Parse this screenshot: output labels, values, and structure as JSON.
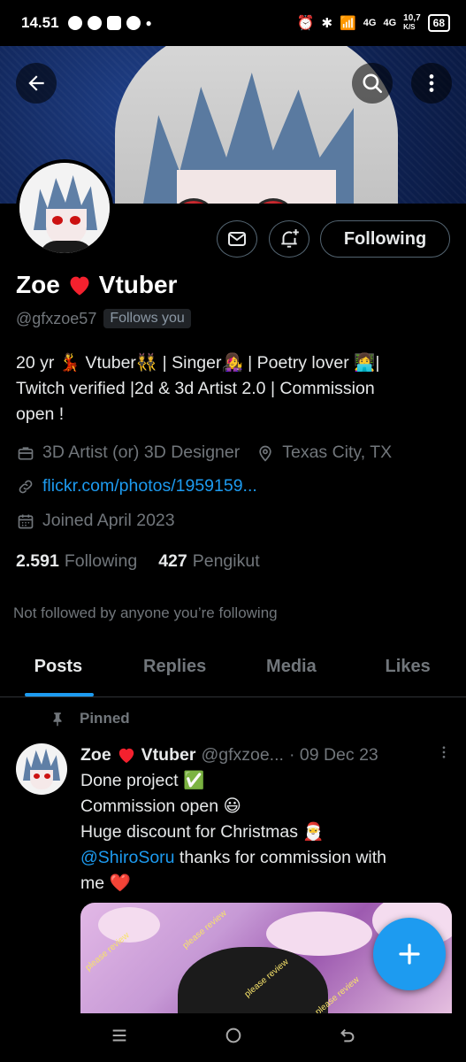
{
  "status_bar": {
    "time": "14.51",
    "network_1": "4G",
    "network_2": "4G",
    "speed": "10,7",
    "speed_unit": "K/S",
    "battery": "68"
  },
  "profile": {
    "name": "Zoe",
    "name_suffix": "Vtuber",
    "handle": "@gfxzoe57",
    "follows_you": "Follows you",
    "bio_line1": "20 yr 💃 Vtuber👯 | Singer👩‍🎤 | Poetry lover 👩‍💻|",
    "bio_line2": "Twitch verified |2d & 3d Artist 2.0 | Commission",
    "bio_line3": "open !",
    "profession": "3D Artist (or) 3D Designer",
    "location": "Texas City, TX",
    "website": "flickr.com/photos/1959159...",
    "joined": "Joined April 2023",
    "following_count": "2.591",
    "following_label": "Following",
    "followers_count": "427",
    "followers_label": "Pengikut",
    "not_followed": "Not followed by anyone you’re following"
  },
  "actions": {
    "following_button": "Following"
  },
  "tabs": [
    {
      "label": "Posts"
    },
    {
      "label": "Replies"
    },
    {
      "label": "Media"
    },
    {
      "label": "Likes"
    }
  ],
  "post": {
    "pinned_label": "Pinned",
    "author_name": "Zoe",
    "author_suffix": "Vtuber",
    "author_handle": "@gfxzoe...",
    "date": "· 09 Dec 23",
    "line1": "Done project ✅",
    "line2": "Commission open 😃",
    "line3": "Huge discount for Christmas 🎅",
    "mention": "@ShiroSoru",
    "line4_rest": " thanks for commission with",
    "line5": "me ❤️",
    "watermark": "please review"
  },
  "colors": {
    "accent": "#1d9bf0",
    "background": "#000000",
    "secondary_text": "#71767b",
    "heart": "#f4212e"
  },
  "icons": [
    "back-arrow-icon",
    "search-icon",
    "more-vertical-icon",
    "message-icon",
    "notification-add-icon",
    "briefcase-icon",
    "location-pin-icon",
    "link-icon",
    "calendar-icon",
    "pin-icon",
    "plus-icon"
  ]
}
